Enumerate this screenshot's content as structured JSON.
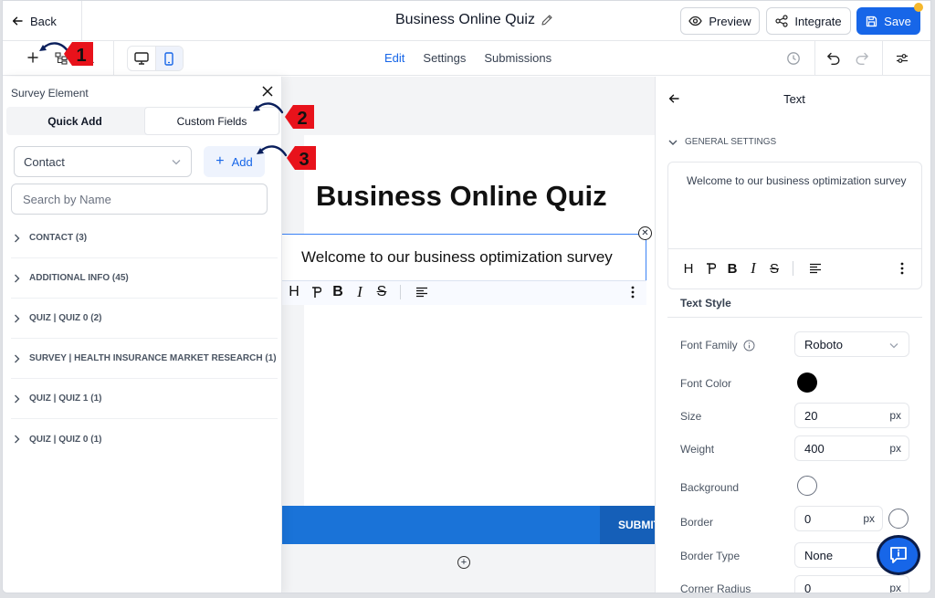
{
  "header": {
    "back_label": "Back",
    "title": "Business Online Quiz",
    "preview_label": "Preview",
    "integrate_label": "Integrate",
    "save_label": "Save"
  },
  "toolbar": {
    "tabs": [
      {
        "label": "Edit",
        "active": true
      },
      {
        "label": "Settings",
        "active": false
      },
      {
        "label": "Submissions",
        "active": false
      }
    ]
  },
  "canvas": {
    "quiz_title": "Business Online Quiz",
    "welcome_text": "Welcome to our business optimization survey",
    "submit_label": "SUBMIT"
  },
  "left_panel": {
    "title": "Survey Element",
    "tabs": {
      "quick_add": "Quick Add",
      "custom_fields": "Custom Fields"
    },
    "select_value": "Contact",
    "add_label": "Add",
    "search_placeholder": "Search by Name",
    "groups": [
      "CONTACT (3)",
      "ADDITIONAL INFO (45)",
      "QUIZ | QUIZ 0 (2)",
      "SURVEY | HEALTH INSURANCE MARKET RESEARCH (1)",
      "QUIZ | QUIZ 1 (1)",
      "QUIZ | QUIZ 0 (1)"
    ]
  },
  "right_panel": {
    "title": "Text",
    "general_settings": "GENERAL SETTINGS",
    "editor_text": "Welcome to our business optimization survey",
    "text_style": "Text Style",
    "font_family_label": "Font Family",
    "font_family_value": "Roboto",
    "font_color_label": "Font Color",
    "font_color_value": "#000000",
    "size_label": "Size",
    "size_value": "20",
    "weight_label": "Weight",
    "weight_value": "400",
    "background_label": "Background",
    "border_label": "Border",
    "border_value": "0",
    "border_type_label": "Border Type",
    "border_type_value": "None",
    "corner_radius_label": "Corner Radius",
    "corner_radius_value": "0",
    "unit": "px"
  },
  "annotations": [
    "1",
    "2",
    "3"
  ],
  "colors": {
    "accent": "#1766e8",
    "submit": "#1a73d8",
    "badge": "#e8121b"
  }
}
